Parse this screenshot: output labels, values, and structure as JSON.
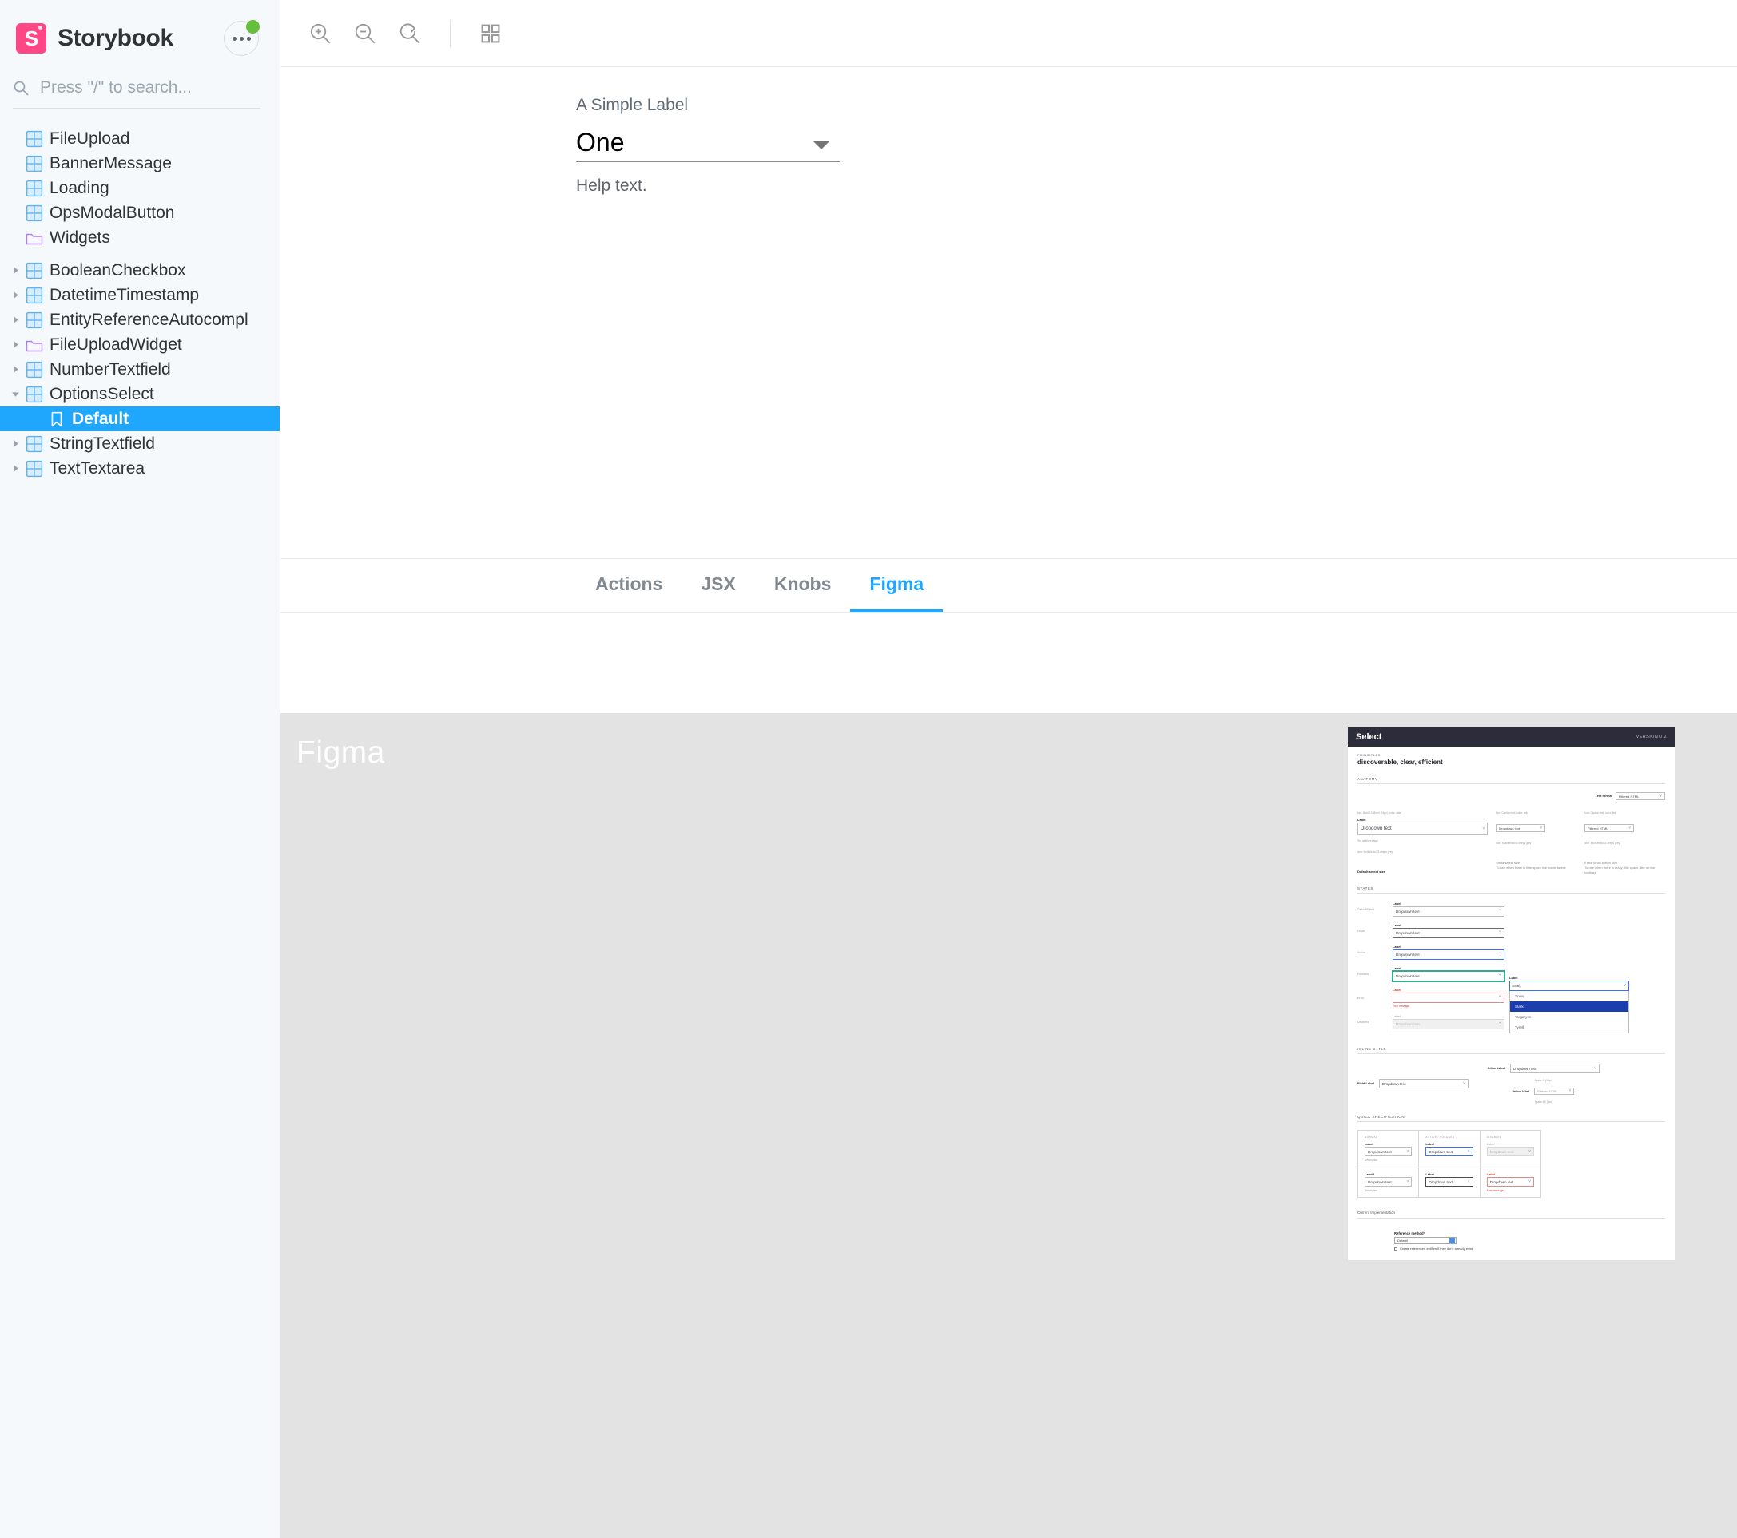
{
  "sidebar": {
    "brand": "Storybook",
    "logo_icon": "storybook-logo",
    "menu_icon": "ellipsis-icon",
    "status_icon": "status-dot-green",
    "search": {
      "placeholder": "Press \"/\" to search...",
      "value": "",
      "icon": "search-icon"
    },
    "items": [
      {
        "label": "FileUpload",
        "icon": "component-grid-icon",
        "depth": 1,
        "caret": "none",
        "selected": false
      },
      {
        "label": "BannerMessage",
        "icon": "component-grid-icon",
        "depth": 1,
        "caret": "none",
        "selected": false
      },
      {
        "label": "Loading",
        "icon": "component-grid-icon",
        "depth": 1,
        "caret": "none",
        "selected": false
      },
      {
        "label": "OpsModalButton",
        "icon": "component-grid-icon",
        "depth": 1,
        "caret": "none",
        "selected": false
      },
      {
        "label": "Widgets",
        "icon": "folder-icon",
        "depth": 1,
        "caret": "none",
        "selected": false
      },
      {
        "label": "BooleanCheckbox",
        "icon": "component-grid-icon",
        "depth": 2,
        "caret": "right",
        "selected": false
      },
      {
        "label": "DatetimeTimestamp",
        "icon": "component-grid-icon",
        "depth": 2,
        "caret": "right",
        "selected": false
      },
      {
        "label": "EntityReferenceAutocompl",
        "icon": "component-grid-icon",
        "depth": 2,
        "caret": "right",
        "selected": false
      },
      {
        "label": "FileUploadWidget",
        "icon": "folder-icon",
        "depth": 2,
        "caret": "right",
        "selected": false
      },
      {
        "label": "NumberTextfield",
        "icon": "component-grid-icon",
        "depth": 2,
        "caret": "right",
        "selected": false
      },
      {
        "label": "OptionsSelect",
        "icon": "component-grid-icon",
        "depth": 2,
        "caret": "down",
        "selected": false
      },
      {
        "label": "Default",
        "icon": "bookmark-icon",
        "depth": 3,
        "caret": "none",
        "selected": true
      },
      {
        "label": "StringTextfield",
        "icon": "component-grid-icon",
        "depth": 2,
        "caret": "right",
        "selected": false
      },
      {
        "label": "TextTextarea",
        "icon": "component-grid-icon",
        "depth": 2,
        "caret": "right",
        "selected": false
      }
    ]
  },
  "toolbar": {
    "buttons": [
      {
        "name": "zoom-in-icon",
        "title": "Zoom in"
      },
      {
        "name": "zoom-out-icon",
        "title": "Zoom out"
      },
      {
        "name": "zoom-reset-icon",
        "title": "Reset zoom"
      },
      {
        "name": "grid-background-icon",
        "title": "Change background"
      }
    ]
  },
  "preview": {
    "label": "A Simple Label",
    "value": "One",
    "help_text": "Help text.",
    "dropdown_icon": "chevron-down-icon"
  },
  "addons": {
    "tabs": [
      {
        "label": "Actions",
        "active": false
      },
      {
        "label": "JSX",
        "active": false
      },
      {
        "label": "Knobs",
        "active": false
      },
      {
        "label": "Figma",
        "active": true
      }
    ],
    "accent": "#1ea7fd"
  },
  "figma": {
    "watermark": "Figma",
    "doc": {
      "title": "Select",
      "version": "VERSION 0.2",
      "principles_eyebrow": "PRINCIPLES",
      "principles": "discoverable, clear, efficient",
      "sections": {
        "anatomy": "ANATOMY",
        "states": "STATES",
        "inline_style": "INLINE STYLE",
        "quick_spec": "QUICK SPECIFICATION",
        "current_impl": "Current Implementation"
      },
      "anatomy": {
        "label": "Label",
        "value": "Dropdown text",
        "notes": [
          "font: Bold 0.938rem (15px), color: slate",
          "font: Caption text, color: teal",
          "Tex radii/grey/blue",
          "icon: Multi-fields/53 deeps grey",
          "4px",
          "1rem",
          "8px"
        ],
        "columns": [
          {
            "cap": "Default select size",
            "sub": ""
          },
          {
            "cap": "Small select size",
            "sub": "To use when there is little space like inside tables"
          },
          {
            "cap": "Extra Small button size",
            "sub": "To use when there is really little space, like on the toolbars"
          }
        ],
        "text_format_label": "Text format",
        "text_format_value": "Filtered HTML"
      },
      "states": {
        "rows": [
          {
            "state": "Default/Filled",
            "label": "Label",
            "value": "Dropdown text"
          },
          {
            "state": "Hover",
            "label": "Label",
            "value": "Dropdown text"
          },
          {
            "state": "Active",
            "label": "Label",
            "value": "Dropdown text"
          },
          {
            "state": "Focused",
            "label": "Label",
            "value": "Dropdown text"
          },
          {
            "state": "Error",
            "label": "Label",
            "value": "",
            "error": "Error message."
          },
          {
            "state": "Disabled",
            "label": "Label",
            "value": "Dropdown text"
          }
        ],
        "open_dropdown": {
          "label": "Label",
          "value": "Stark",
          "options": [
            "Snow",
            "Stark",
            "Targaryen",
            "Tyrell"
          ],
          "selected": "Stark"
        }
      },
      "inline_style": {
        "field_label": "Field Label",
        "field_value": "Dropdown text",
        "inline_label": "Inline Label",
        "inline_value": "Dropdown text",
        "inline_label_2": "Inline label",
        "inline_value_2": "Filtered HTML",
        "space_note_1": "Space M (16px)",
        "space_note_2": "Space XS (8px)"
      },
      "quick_spec": {
        "headers": [
          "NORMAL",
          "ACTIVE / FOCUSED",
          "DISABLED"
        ],
        "rows": [
          [
            {
              "label": "Label",
              "value": "Dropdown text",
              "note": "Description."
            },
            {
              "label": "Label",
              "value": "Dropdown text",
              "note": ""
            },
            {
              "label": "Label",
              "value": "Dropdown text",
              "note": ""
            }
          ],
          [
            {
              "label": "Label*",
              "value": "Dropdown text",
              "note": "Description."
            },
            {
              "label": "Label",
              "value": "Dropdown text",
              "note": ""
            },
            {
              "label": "Label",
              "value": "Dropdown text",
              "note": "Error message."
            }
          ]
        ]
      },
      "current_impl": {
        "label": "Reference method",
        "required_mark": "*",
        "value": "Default",
        "checkbox_label": "Create referenced entities if they don't already exist"
      }
    }
  }
}
